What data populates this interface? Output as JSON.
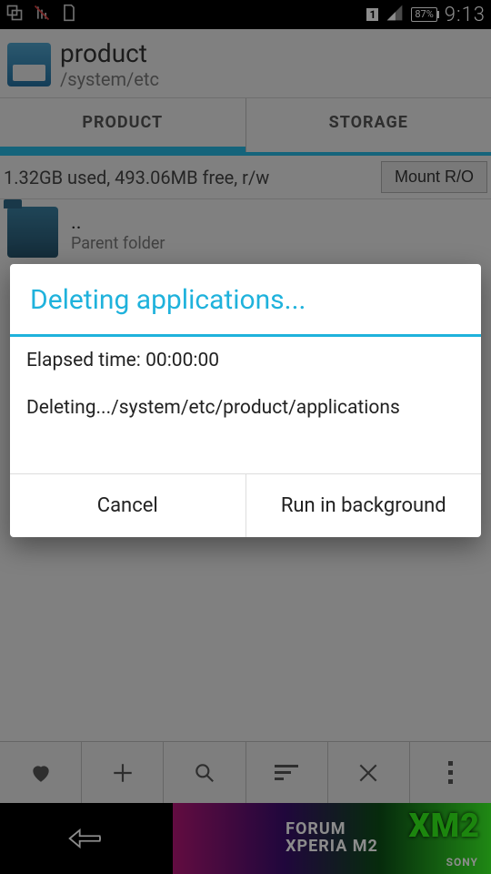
{
  "statusbar": {
    "battery_pct": "87%",
    "clock": "9:13",
    "sim_badge": "1"
  },
  "header": {
    "title": "product",
    "path": "/system/etc"
  },
  "tabs": {
    "product": "PRODUCT",
    "storage": "STORAGE"
  },
  "info": {
    "summary": "1.32GB used, 493.06MB free, r/w",
    "mount_btn": "Mount R/O"
  },
  "parent_row": {
    "name": "..",
    "sub": "Parent folder"
  },
  "dialog": {
    "title": "Deleting applications...",
    "elapsed_label": "Elapsed time: 00:00:00",
    "progress_line": "Deleting.../system/etc/product/applications",
    "cancel": "Cancel",
    "background": "Run in background"
  },
  "ad": {
    "line1": "FORUM",
    "line2": "XPERIA M2",
    "badge": "XM2",
    "brand": "SONY"
  }
}
